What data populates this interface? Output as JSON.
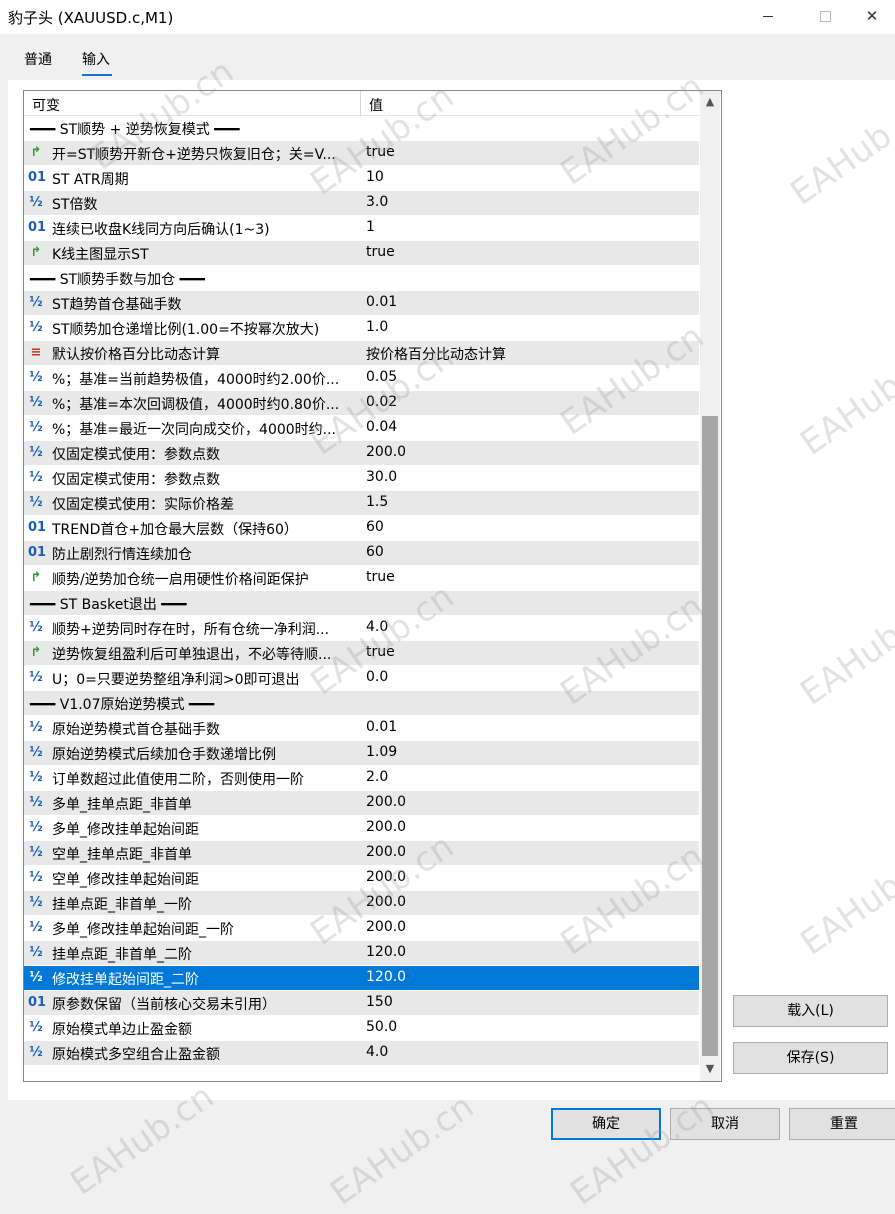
{
  "window": {
    "title": "豹子头 (XAUUSD.c,M1)",
    "minimize_glyph": "—",
    "close_glyph": "✕"
  },
  "tabs": [
    {
      "label": "普通",
      "active": false
    },
    {
      "label": "输入",
      "active": true
    }
  ],
  "grid": {
    "header_name": "可变",
    "header_value": "值",
    "rows": [
      {
        "type": "section",
        "name": "━━━ ST顺势 + 逆势恢复模式 ━━━",
        "value": ""
      },
      {
        "type": "bool",
        "name": "开=ST顺势开新仓+逆势只恢复旧仓；关=V...",
        "value": "true"
      },
      {
        "type": "int",
        "name": "ST ATR周期",
        "value": "10"
      },
      {
        "type": "double",
        "name": "ST倍数",
        "value": "3.0"
      },
      {
        "type": "int",
        "name": "连续已收盘K线同方向后确认(1~3)",
        "value": "1"
      },
      {
        "type": "bool",
        "name": "K线主图显示ST",
        "value": "true"
      },
      {
        "type": "section",
        "name": "━━━ ST顺势手数与加仓 ━━━",
        "value": ""
      },
      {
        "type": "double",
        "name": "ST趋势首仓基础手数",
        "value": "0.01"
      },
      {
        "type": "double",
        "name": "ST顺势加仓递增比例(1.00=不按幂次放大)",
        "value": "1.0"
      },
      {
        "type": "enum",
        "name": "默认按价格百分比动态计算",
        "value": "按价格百分比动态计算"
      },
      {
        "type": "double",
        "name": "%；基准=当前趋势极值，4000时约2.00价...",
        "value": "0.05"
      },
      {
        "type": "double",
        "name": "%；基准=本次回调极值，4000时约0.80价...",
        "value": "0.02"
      },
      {
        "type": "double",
        "name": "%；基准=最近一次同向成交价，4000时约...",
        "value": "0.04"
      },
      {
        "type": "double",
        "name": "仅固定模式使用：参数点数",
        "value": "200.0"
      },
      {
        "type": "double",
        "name": "仅固定模式使用：参数点数",
        "value": "30.0"
      },
      {
        "type": "double",
        "name": "仅固定模式使用：实际价格差",
        "value": "1.5"
      },
      {
        "type": "int",
        "name": "TREND首仓+加仓最大层数（保持60）",
        "value": "60"
      },
      {
        "type": "int",
        "name": "防止剧烈行情连续加仓",
        "value": "60"
      },
      {
        "type": "bool",
        "name": "顺势/逆势加仓统一启用硬性价格间距保护",
        "value": "true"
      },
      {
        "type": "section",
        "name": "━━━ ST Basket退出 ━━━",
        "value": ""
      },
      {
        "type": "double",
        "name": "顺势+逆势同时存在时，所有仓统一净利润...",
        "value": "4.0"
      },
      {
        "type": "bool",
        "name": "逆势恢复组盈利后可单独退出，不必等待顺...",
        "value": "true"
      },
      {
        "type": "double",
        "name": "U；0=只要逆势整组净利润>0即可退出",
        "value": "0.0"
      },
      {
        "type": "section",
        "name": "━━━ V1.07原始逆势模式 ━━━",
        "value": ""
      },
      {
        "type": "double",
        "name": "原始逆势模式首仓基础手数",
        "value": "0.01"
      },
      {
        "type": "double",
        "name": "原始逆势模式后续加仓手数递增比例",
        "value": "1.09"
      },
      {
        "type": "double",
        "name": "订单数超过此值使用二阶，否则使用一阶",
        "value": "2.0"
      },
      {
        "type": "double",
        "name": "多单_挂单点距_非首单",
        "value": "200.0"
      },
      {
        "type": "double",
        "name": "多单_修改挂单起始间距",
        "value": "200.0"
      },
      {
        "type": "double",
        "name": "空单_挂单点距_非首单",
        "value": "200.0"
      },
      {
        "type": "double",
        "name": "空单_修改挂单起始间距",
        "value": "200.0"
      },
      {
        "type": "double",
        "name": "挂单点距_非首单_一阶",
        "value": "200.0"
      },
      {
        "type": "double",
        "name": "多单_修改挂单起始间距_一阶",
        "value": "200.0"
      },
      {
        "type": "double",
        "name": "挂单点距_非首单_二阶",
        "value": "120.0"
      },
      {
        "type": "double",
        "name": "修改挂单起始间距_二阶",
        "value": "120.0",
        "selected": true
      },
      {
        "type": "int",
        "name": "原参数保留（当前核心交易未引用）",
        "value": "150"
      },
      {
        "type": "double",
        "name": "原始模式单边止盈金额",
        "value": "50.0"
      },
      {
        "type": "double",
        "name": "原始模式多空组合止盈金额",
        "value": "4.0"
      }
    ]
  },
  "icons": {
    "int": "01",
    "double": "½",
    "bool": "↱",
    "enum": "≡"
  },
  "buttons": {
    "load": "载入(L)",
    "save": "保存(S)",
    "ok": "确定",
    "cancel": "取消",
    "reset": "重置"
  },
  "watermark": "EAHub.cn"
}
